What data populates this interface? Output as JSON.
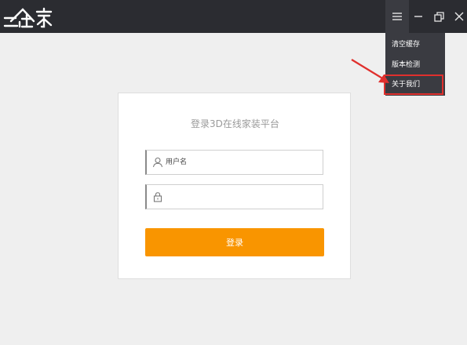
{
  "app": {
    "logo_text": "三维家"
  },
  "window_controls": {
    "menu_icon": "hamburger-icon",
    "minimize_icon": "minimize-icon",
    "restore_icon": "restore-icon",
    "close_icon": "close-icon"
  },
  "menu": {
    "items": [
      {
        "label": "清空缓存"
      },
      {
        "label": "版本检测"
      },
      {
        "label": "关于我们"
      }
    ]
  },
  "annotation": {
    "highlight_color": "#e0302d"
  },
  "login": {
    "title": "登录3D在线家装平台",
    "username": {
      "placeholder": "用户名",
      "icon": "user-icon"
    },
    "password": {
      "placeholder": "",
      "icon": "lock-icon"
    },
    "submit_label": "登录",
    "button_color": "#f99500"
  }
}
